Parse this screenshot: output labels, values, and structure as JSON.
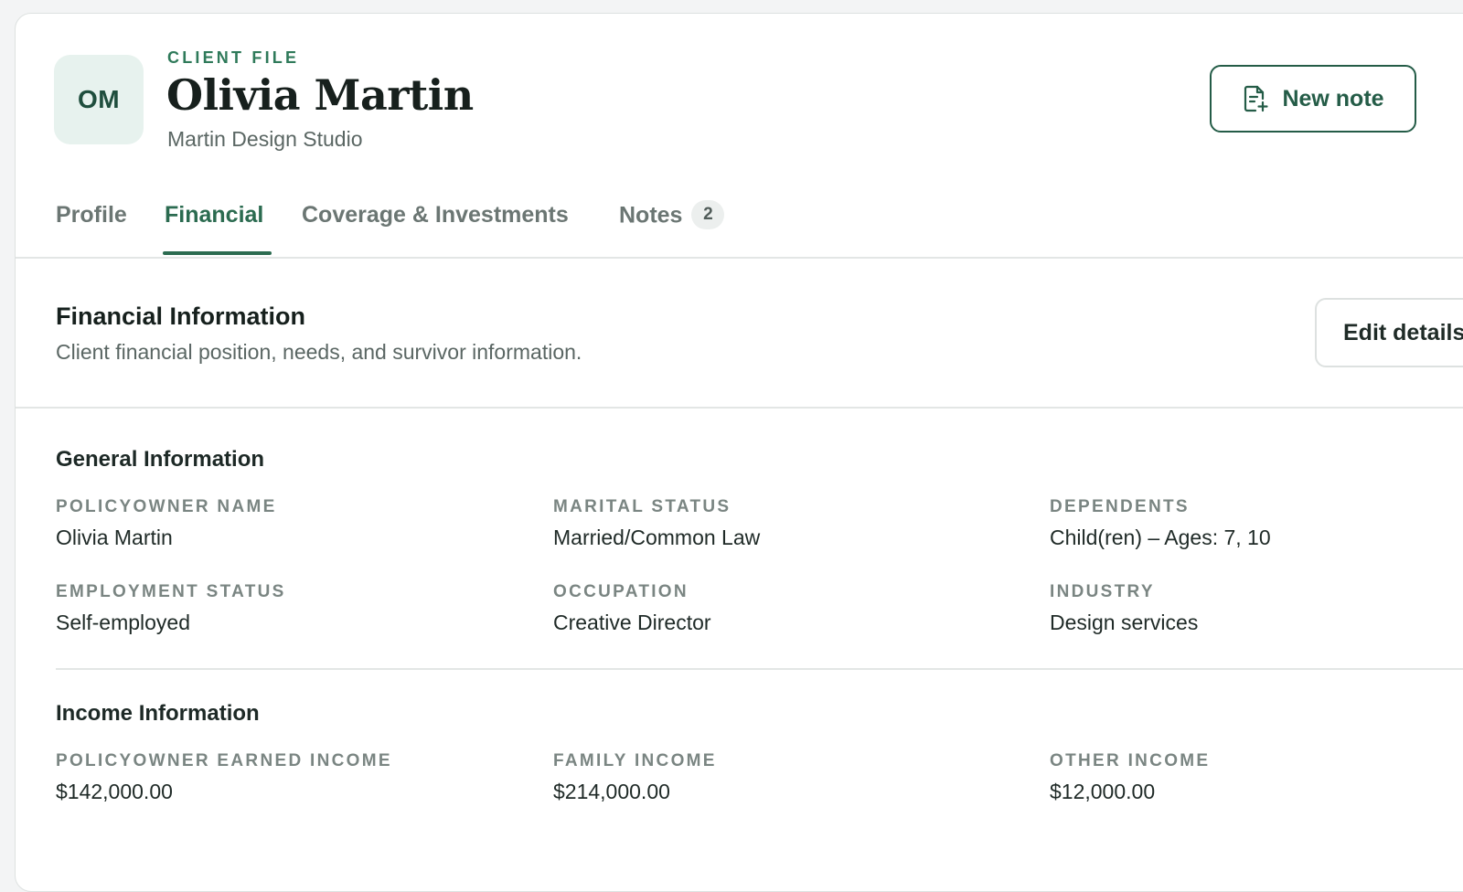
{
  "client": {
    "initials": "OM",
    "eyebrow": "CLIENT FILE",
    "name": "Olivia Martin",
    "company": "Martin Design Studio"
  },
  "actions": {
    "new_note_label": "New note",
    "edit_label": "Edit details"
  },
  "tabs": [
    {
      "label": "Profile",
      "active": false
    },
    {
      "label": "Financial",
      "active": true
    },
    {
      "label": "Coverage & Investments",
      "active": false
    },
    {
      "label": "Notes",
      "active": false,
      "badge": "2"
    }
  ],
  "section": {
    "title": "Financial Information",
    "description": "Client financial position, needs, and survivor information."
  },
  "general": {
    "title": "General Information",
    "fields": [
      {
        "label": "POLICYOWNER NAME",
        "value": "Olivia Martin"
      },
      {
        "label": "MARITAL STATUS",
        "value": "Married/Common Law"
      },
      {
        "label": "DEPENDENTS",
        "value": "Child(ren) – Ages: 7, 10"
      },
      {
        "label": "EMPLOYMENT STATUS",
        "value": "Self-employed"
      },
      {
        "label": "OCCUPATION",
        "value": "Creative Director"
      },
      {
        "label": "INDUSTRY",
        "value": "Design services"
      }
    ]
  },
  "income": {
    "title": "Income Information",
    "fields": [
      {
        "label": "POLICYOWNER EARNED INCOME",
        "value": "$142,000.00"
      },
      {
        "label": "FAMILY INCOME",
        "value": "$214,000.00"
      },
      {
        "label": "OTHER INCOME",
        "value": "$12,000.00"
      }
    ]
  },
  "colors": {
    "accent": "#2b6b50",
    "avatar_bg": "#e7f2ee",
    "page_bg": "#f3f4f5"
  }
}
